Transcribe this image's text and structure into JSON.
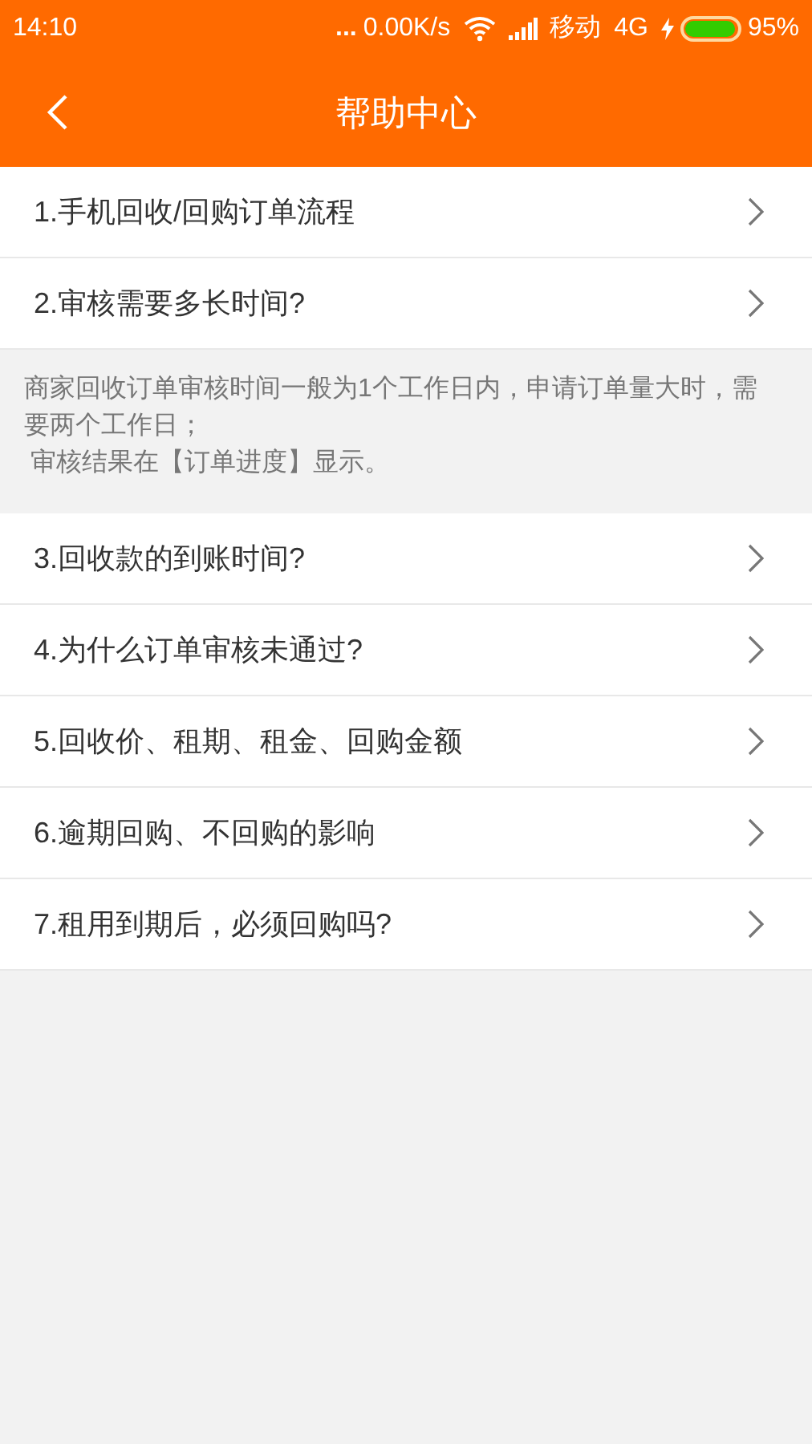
{
  "status_bar": {
    "time": "14:10",
    "more": "...",
    "speed": "0.00K/s",
    "carrier": "移动",
    "network": "4G",
    "battery": "95%"
  },
  "header": {
    "title": "帮助中心"
  },
  "items": [
    {
      "label": "1.手机回收/回购订单流程"
    },
    {
      "label": "2.审核需要多长时间?",
      "answer": [
        "商家回收订单审核时间一般为1个工作日内，申请订单量大时，需要两个工作日；",
        "审核结果在【订单进度】显示。"
      ]
    },
    {
      "label": "3.回收款的到账时间?"
    },
    {
      "label": "4.为什么订单审核未通过?"
    },
    {
      "label": "5.回收价、租期、租金、回购金额"
    },
    {
      "label": "6.逾期回购、不回购的影响"
    },
    {
      "label": "7.租用到期后，必须回购吗?"
    }
  ]
}
